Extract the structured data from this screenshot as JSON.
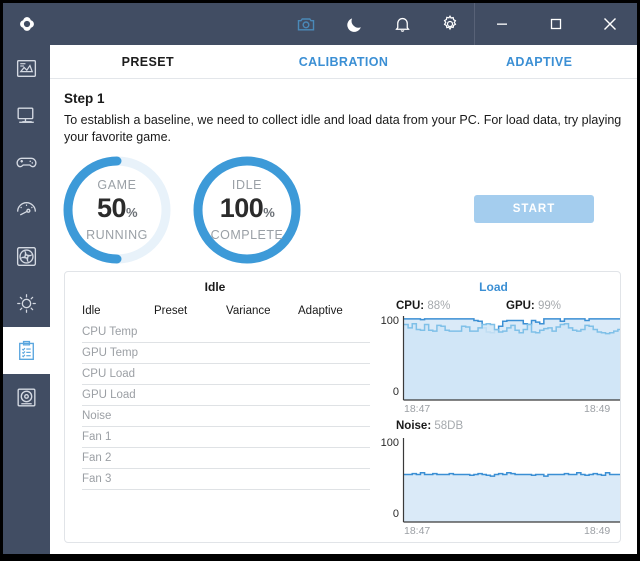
{
  "titlebar": {
    "logo_icon": "app-logo-icon",
    "buttons": [
      {
        "name": "screenshot-button",
        "icon": "camera-icon",
        "accent": "#4a89b8"
      },
      {
        "name": "night-mode-button",
        "icon": "moon-icon",
        "accent": "#ffffff"
      },
      {
        "name": "notifications-button",
        "icon": "bell-icon",
        "accent": "#ffffff"
      },
      {
        "name": "settings-button",
        "icon": "gear-icon",
        "accent": "#ffffff"
      }
    ],
    "window_controls": [
      {
        "name": "minimize-button",
        "icon": "minimize-icon"
      },
      {
        "name": "maximize-button",
        "icon": "maximize-icon"
      },
      {
        "name": "close-button",
        "icon": "close-icon"
      }
    ]
  },
  "sidebar": {
    "items": [
      {
        "name": "sidebar-item-monitoring",
        "icon": "chart-document-icon",
        "active": false
      },
      {
        "name": "sidebar-item-desktop",
        "icon": "desktop-monitor-icon",
        "active": false
      },
      {
        "name": "sidebar-item-gaming",
        "icon": "gamepad-icon",
        "active": false
      },
      {
        "name": "sidebar-item-performance",
        "icon": "speedometer-icon",
        "active": false
      },
      {
        "name": "sidebar-item-fan",
        "icon": "fan-icon",
        "active": false
      },
      {
        "name": "sidebar-item-lighting",
        "icon": "sun-brightness-icon",
        "active": false
      },
      {
        "name": "sidebar-item-calibration",
        "icon": "clipboard-checklist-icon",
        "active": true
      },
      {
        "name": "sidebar-item-drive",
        "icon": "disc-drive-icon",
        "active": false
      }
    ]
  },
  "tabs": [
    {
      "label": "PRESET",
      "active": true
    },
    {
      "label": "CALIBRATION",
      "active": false
    },
    {
      "label": "ADAPTIVE",
      "active": false
    }
  ],
  "step": {
    "title": "Step 1",
    "description": "To establish a baseline, we need to collect idle and load data from your PC. For load data, try playing your favorite game."
  },
  "gauges": [
    {
      "name": "game-gauge",
      "label": "GAME",
      "value": "50",
      "unit": "%",
      "state": "RUNNING",
      "percent": 50,
      "ring_color": "#3d9ad8",
      "track_color": "#e8f2fa"
    },
    {
      "name": "idle-gauge",
      "label": "IDLE",
      "value": "100",
      "unit": "%",
      "state": "COMPLETE",
      "percent": 100,
      "ring_color": "#3d9ad8",
      "track_color": "#e8f2fa"
    }
  ],
  "start_button": {
    "label": "START",
    "color": "#a4cdee"
  },
  "panel": {
    "table": {
      "title": "Idle",
      "columns": [
        "Idle",
        "Preset",
        "Variance",
        "Adaptive"
      ],
      "rows": [
        {
          "label": "CPU Temp",
          "preset": "",
          "variance": "",
          "adaptive": ""
        },
        {
          "label": "GPU Temp",
          "preset": "",
          "variance": "",
          "adaptive": ""
        },
        {
          "label": "CPU Load",
          "preset": "",
          "variance": "",
          "adaptive": ""
        },
        {
          "label": "GPU Load",
          "preset": "",
          "variance": "",
          "adaptive": ""
        },
        {
          "label": "Noise",
          "preset": "",
          "variance": "",
          "adaptive": ""
        },
        {
          "label": "Fan 1",
          "preset": "",
          "variance": "",
          "adaptive": ""
        },
        {
          "label": "Fan 2",
          "preset": "",
          "variance": "",
          "adaptive": ""
        },
        {
          "label": "Fan 3",
          "preset": "",
          "variance": "",
          "adaptive": ""
        }
      ]
    },
    "charts_title": "Load"
  },
  "chart_data": [
    {
      "type": "area",
      "name": "load-chart",
      "title": "Load",
      "legend": [
        {
          "name": "CPU",
          "value": "88%"
        },
        {
          "name": "GPU",
          "value": "99%"
        }
      ],
      "ylabel": "",
      "ylim": [
        0,
        100
      ],
      "yticks": [
        "100",
        "0"
      ],
      "x": [
        "18:47",
        "18:49"
      ],
      "xlabel": "",
      "grid": false,
      "legend_position": "top",
      "series": [
        {
          "name": "GPU",
          "color": "#3b8fd4",
          "fill": "#d6e8f7",
          "values": [
            99,
            99,
            99,
            99,
            98,
            99,
            99,
            99,
            99,
            99,
            99,
            99,
            99,
            99,
            99,
            99,
            99,
            97,
            96,
            88,
            83,
            82,
            85,
            90,
            96,
            97,
            97,
            97,
            97,
            93,
            92,
            97,
            95,
            93,
            99,
            99,
            99,
            99,
            96,
            99,
            99,
            99,
            99,
            99,
            97,
            99,
            99,
            99,
            99,
            99,
            99,
            99,
            99,
            99
          ]
        },
        {
          "name": "CPU",
          "color": "#7fc0e8",
          "fill": "#cfe5f6",
          "values": [
            92,
            88,
            93,
            86,
            85,
            92,
            85,
            84,
            91,
            90,
            85,
            84,
            84,
            84,
            90,
            89,
            84,
            84,
            88,
            92,
            93,
            92,
            86,
            83,
            84,
            88,
            91,
            85,
            82,
            86,
            92,
            83,
            82,
            85,
            87,
            88,
            84,
            89,
            92,
            93,
            88,
            85,
            84,
            86,
            91,
            90,
            86,
            83,
            82,
            81,
            82,
            84,
            86,
            88
          ]
        }
      ]
    },
    {
      "type": "area",
      "name": "noise-chart",
      "title": "Noise",
      "legend": [
        {
          "name": "Noise",
          "value": "58DB"
        }
      ],
      "ylabel": "",
      "ylim": [
        0,
        100
      ],
      "yticks": [
        "100",
        "0"
      ],
      "x": [
        "18:47",
        "18:49"
      ],
      "xlabel": "",
      "grid": false,
      "legend_position": "top",
      "series": [
        {
          "name": "Noise",
          "color": "#3b8fd4",
          "fill": "#d6e8f7",
          "values": [
            58,
            58,
            59,
            58,
            60,
            58,
            58,
            59,
            58,
            58,
            58,
            59,
            58,
            58,
            58,
            58,
            57,
            58,
            59,
            58,
            57,
            56,
            58,
            59,
            58,
            60,
            59,
            58,
            58,
            58,
            58,
            57,
            58,
            58,
            56,
            58,
            58,
            58,
            58,
            59,
            58,
            58,
            60,
            58,
            57,
            58,
            59,
            58,
            57,
            60,
            58,
            58,
            58,
            58
          ]
        }
      ]
    }
  ]
}
